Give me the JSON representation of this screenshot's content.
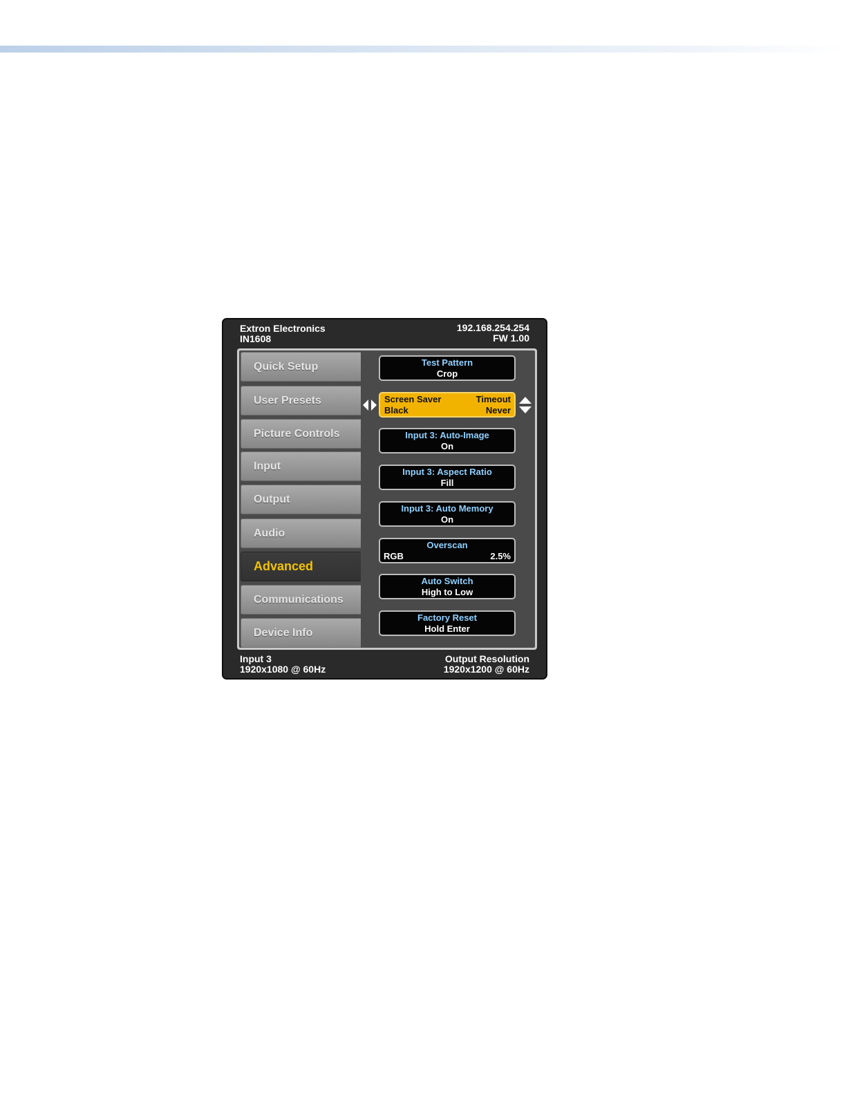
{
  "header": {
    "company": "Extron Electronics",
    "model": "IN1608",
    "ip": "192.168.254.254",
    "firmware": "FW 1.00"
  },
  "footer": {
    "input_name": "Input 3",
    "input_resolution": "1920x1080 @ 60Hz",
    "output_label": "Output Resolution",
    "output_resolution": "1920x1200 @ 60Hz"
  },
  "menu": {
    "items": [
      {
        "label": "Quick Setup"
      },
      {
        "label": "User Presets"
      },
      {
        "label": "Picture Controls"
      },
      {
        "label": "Input"
      },
      {
        "label": "Output"
      },
      {
        "label": "Audio"
      },
      {
        "label": "Advanced"
      },
      {
        "label": "Communications"
      },
      {
        "label": "Device Info"
      }
    ],
    "selected": "Advanced"
  },
  "settings": [
    {
      "label": "Test Pattern",
      "value": "Crop"
    },
    {
      "label": "Screen Saver",
      "label2": "Timeout",
      "value": "Black",
      "value2": "Never"
    },
    {
      "label": "Input 3: Auto-Image",
      "value": "On"
    },
    {
      "label": "Input 3: Aspect Ratio",
      "value": "Fill"
    },
    {
      "label": "Input 3: Auto Memory",
      "value": "On"
    },
    {
      "label": "Overscan",
      "value": "RGB",
      "value2": "2.5%"
    },
    {
      "label": "Auto Switch",
      "value": "High to Low"
    },
    {
      "label": "Factory Reset",
      "value": "Hold Enter"
    }
  ],
  "colors": {
    "highlight": "#f2b300",
    "selected_text": "#f2c300",
    "setting_label": "#8fd0ff"
  }
}
